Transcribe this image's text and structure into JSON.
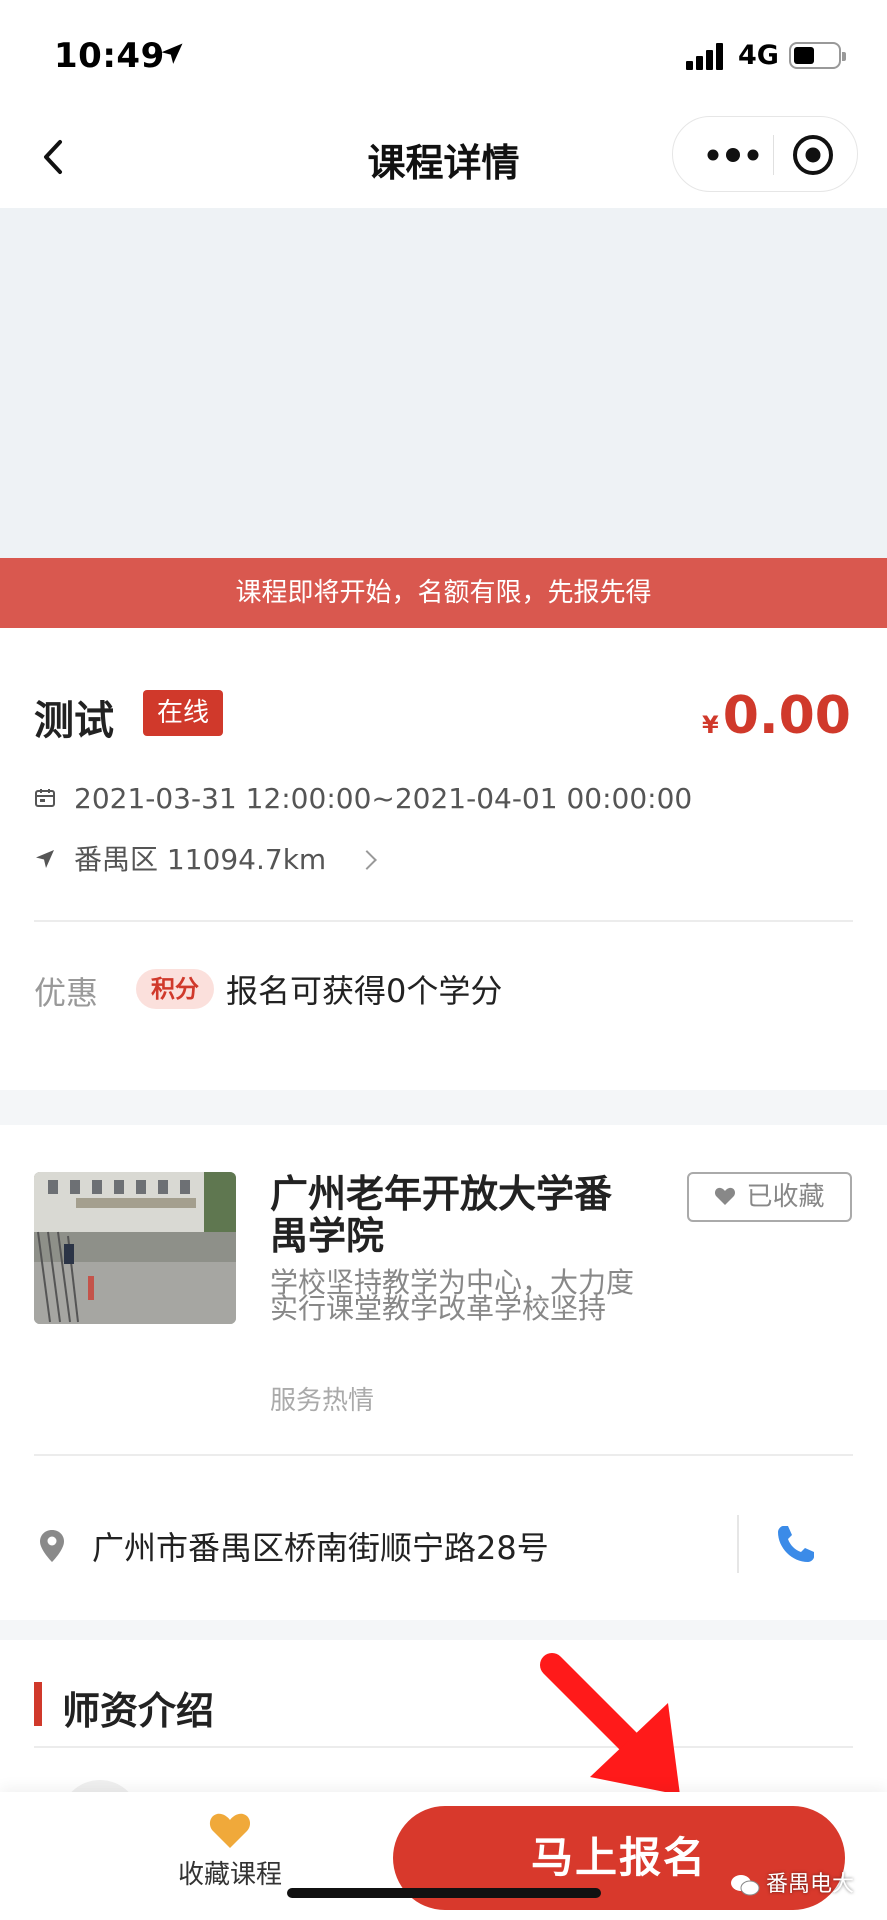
{
  "status_bar": {
    "time": "10:49",
    "network": "4G"
  },
  "nav": {
    "title": "课程详情"
  },
  "notice": "课程即将开始，名额有限，先报先得",
  "course": {
    "title": "测试",
    "mode": "在线",
    "price_symbol": "¥",
    "price": "0.00",
    "datetime": "2021-03-31 12:00:00~2021-04-01 00:00:00",
    "location": "番禺区 11094.7km",
    "promo_label": "优惠",
    "promo_badge": "积分",
    "promo_text": "报名可获得0个学分"
  },
  "school": {
    "name": "广州老年开放大学番禺学院",
    "description": "学校坚持教学为中心，大力度实行课堂教学改革学校坚持",
    "tag": "服务热情",
    "favorite_label": "已收藏",
    "address": "广州市番禺区桥南街顺宁路28号"
  },
  "teachers": {
    "section_title": "师资介绍"
  },
  "bottom_bar": {
    "favorite_label": "收藏课程",
    "enroll_label": "马上报名"
  },
  "watermark": "番禺电大",
  "colors": {
    "accent": "#d0392b",
    "notice": "#d9584f",
    "favorite_icon": "#f0a93a",
    "phone_icon": "#3b8be8"
  }
}
